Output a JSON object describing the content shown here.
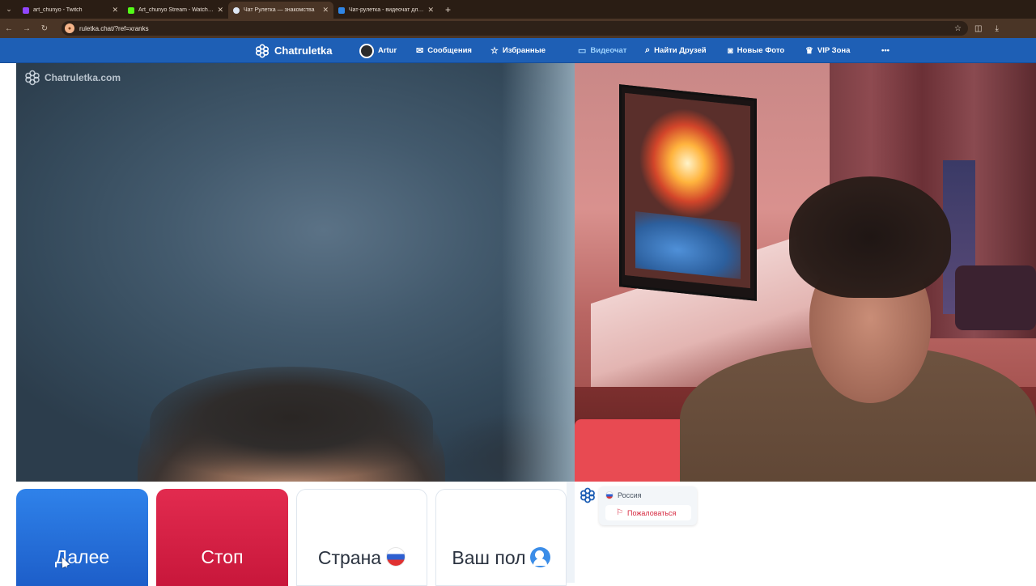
{
  "browser": {
    "tabs": [
      {
        "title": "art_chunyo - Twitch",
        "favicon_color": "#9146ff"
      },
      {
        "title": "Art_chunyo Stream - Watch Live",
        "favicon_color": "#53fc18"
      },
      {
        "title": "Чат Рулетка — знакомства",
        "favicon_color": "#ffffff"
      },
      {
        "title": "Чат-рулетка - видеочат для с...",
        "favicon_color": "#2f86e6"
      }
    ],
    "new_tab_label": "+",
    "url": "ruletka.chat/?ref=xranks"
  },
  "navbar": {
    "brand": "Chatruletka",
    "user": "Artur",
    "messages": "Сообщения",
    "favorites": "Избранные",
    "videochat": "Видеочат",
    "find_friends": "Найти Друзей",
    "new_photos": "Новые Фото",
    "vip": "VIP Зона",
    "more": "•••"
  },
  "video": {
    "watermark": "Chatruletka.com"
  },
  "controls": {
    "next": "Далее",
    "stop": "Стоп",
    "country": "Страна",
    "gender": "Ваш пол"
  },
  "partner": {
    "country": "Россия",
    "report": "Пожаловаться"
  },
  "colors": {
    "navbar": "#1e5fb5",
    "next_button": "#2f82ea",
    "stop_button": "#e22b4f",
    "report_text": "#d6283f"
  }
}
